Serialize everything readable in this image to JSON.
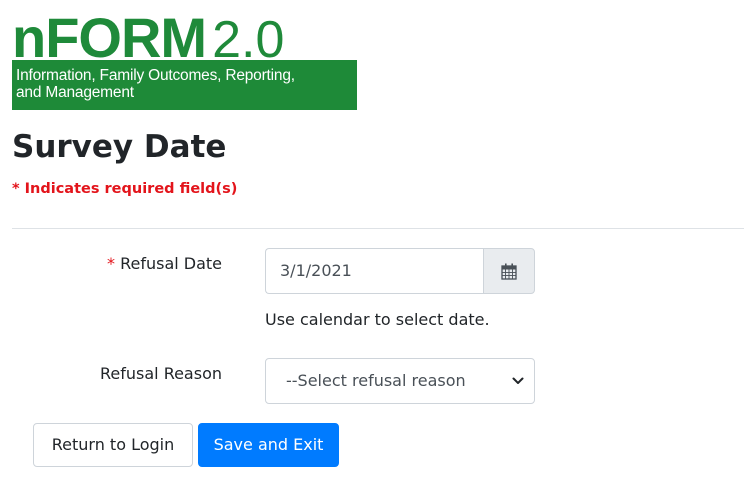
{
  "logo": {
    "prefix": "n",
    "name": "FORM",
    "version": "2.0",
    "tagline_line1": "Information, Family Outcomes, Reporting,",
    "tagline_line2": "and Management"
  },
  "page_title": "Survey Date",
  "required_note": "* Indicates required field(s)",
  "form": {
    "refusal_date": {
      "required_marker": "*",
      "label": "Refusal Date",
      "value": "3/1/2021",
      "help": "Use calendar to select date.",
      "icon": "calendar-icon"
    },
    "refusal_reason": {
      "label": "Refusal Reason",
      "selected": "--Select refusal reason",
      "icon": "chevron-down-icon"
    }
  },
  "buttons": {
    "return_label": "Return to Login",
    "save_label": "Save and Exit"
  },
  "colors": {
    "brand_green": "#1e8a38",
    "required_red": "#e3141b",
    "primary_blue": "#007bff"
  }
}
